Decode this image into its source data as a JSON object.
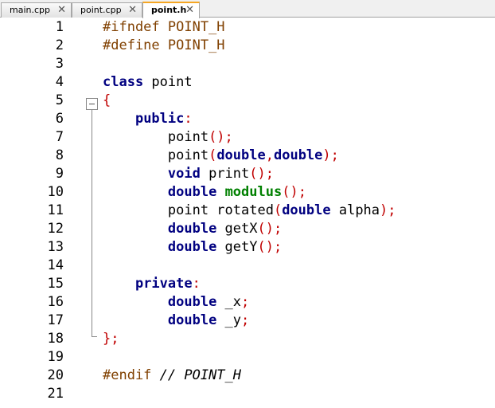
{
  "tabs": [
    {
      "label": "main.cpp",
      "active": false
    },
    {
      "label": "point.cpp",
      "active": false
    },
    {
      "label": "point.h",
      "active": true
    }
  ],
  "icons": {
    "tab_close": "close-icon",
    "fold": "fold-collapse-icon"
  },
  "colors": {
    "keyword": "#000080",
    "preprocessor": "#804000",
    "operator": "#c00000",
    "function": "#008000",
    "active_tab_accent": "#f5a623"
  },
  "lines": [
    {
      "num": "1",
      "tokens": [
        {
          "t": "#ifndef POINT_H",
          "c": "pp"
        }
      ]
    },
    {
      "num": "2",
      "tokens": [
        {
          "t": "#define POINT_H",
          "c": "pp"
        }
      ]
    },
    {
      "num": "3",
      "tokens": []
    },
    {
      "num": "4",
      "tokens": [
        {
          "t": "class",
          "c": "kw"
        },
        {
          "t": " point",
          "c": ""
        }
      ]
    },
    {
      "num": "5",
      "tokens": [
        {
          "t": "{",
          "c": "op"
        }
      ]
    },
    {
      "num": "6",
      "tokens": [
        {
          "t": "    ",
          "c": ""
        },
        {
          "t": "public",
          "c": "kw"
        },
        {
          "t": ":",
          "c": "op"
        }
      ]
    },
    {
      "num": "7",
      "tokens": [
        {
          "t": "        point",
          "c": ""
        },
        {
          "t": "();",
          "c": "op"
        }
      ]
    },
    {
      "num": "8",
      "tokens": [
        {
          "t": "        point",
          "c": ""
        },
        {
          "t": "(",
          "c": "op"
        },
        {
          "t": "double",
          "c": "kw"
        },
        {
          "t": ",",
          "c": "op"
        },
        {
          "t": "double",
          "c": "kw"
        },
        {
          "t": ");",
          "c": "op"
        }
      ]
    },
    {
      "num": "9",
      "tokens": [
        {
          "t": "        ",
          "c": ""
        },
        {
          "t": "void",
          "c": "kw"
        },
        {
          "t": " print",
          "c": ""
        },
        {
          "t": "();",
          "c": "op"
        }
      ]
    },
    {
      "num": "10",
      "tokens": [
        {
          "t": "        ",
          "c": ""
        },
        {
          "t": "double",
          "c": "kw"
        },
        {
          "t": " ",
          "c": ""
        },
        {
          "t": "modulus",
          "c": "fn"
        },
        {
          "t": "();",
          "c": "op"
        }
      ]
    },
    {
      "num": "11",
      "tokens": [
        {
          "t": "        point rotated",
          "c": ""
        },
        {
          "t": "(",
          "c": "op"
        },
        {
          "t": "double",
          "c": "kw"
        },
        {
          "t": " alpha",
          "c": ""
        },
        {
          "t": ");",
          "c": "op"
        }
      ]
    },
    {
      "num": "12",
      "tokens": [
        {
          "t": "        ",
          "c": ""
        },
        {
          "t": "double",
          "c": "kw"
        },
        {
          "t": " getX",
          "c": ""
        },
        {
          "t": "();",
          "c": "op"
        }
      ]
    },
    {
      "num": "13",
      "tokens": [
        {
          "t": "        ",
          "c": ""
        },
        {
          "t": "double",
          "c": "kw"
        },
        {
          "t": " getY",
          "c": ""
        },
        {
          "t": "();",
          "c": "op"
        }
      ]
    },
    {
      "num": "14",
      "tokens": []
    },
    {
      "num": "15",
      "tokens": [
        {
          "t": "    ",
          "c": ""
        },
        {
          "t": "private",
          "c": "kw"
        },
        {
          "t": ":",
          "c": "op"
        }
      ]
    },
    {
      "num": "16",
      "tokens": [
        {
          "t": "        ",
          "c": ""
        },
        {
          "t": "double",
          "c": "kw"
        },
        {
          "t": " _x",
          "c": ""
        },
        {
          "t": ";",
          "c": "op"
        }
      ]
    },
    {
      "num": "17",
      "tokens": [
        {
          "t": "        ",
          "c": ""
        },
        {
          "t": "double",
          "c": "kw"
        },
        {
          "t": " _y",
          "c": ""
        },
        {
          "t": ";",
          "c": "op"
        }
      ]
    },
    {
      "num": "18",
      "tokens": [
        {
          "t": "};",
          "c": "op"
        }
      ]
    },
    {
      "num": "19",
      "tokens": []
    },
    {
      "num": "20",
      "tokens": [
        {
          "t": "#endif ",
          "c": "pp"
        },
        {
          "t": "// POINT_H",
          "c": "cm"
        }
      ]
    },
    {
      "num": "21",
      "tokens": []
    }
  ]
}
